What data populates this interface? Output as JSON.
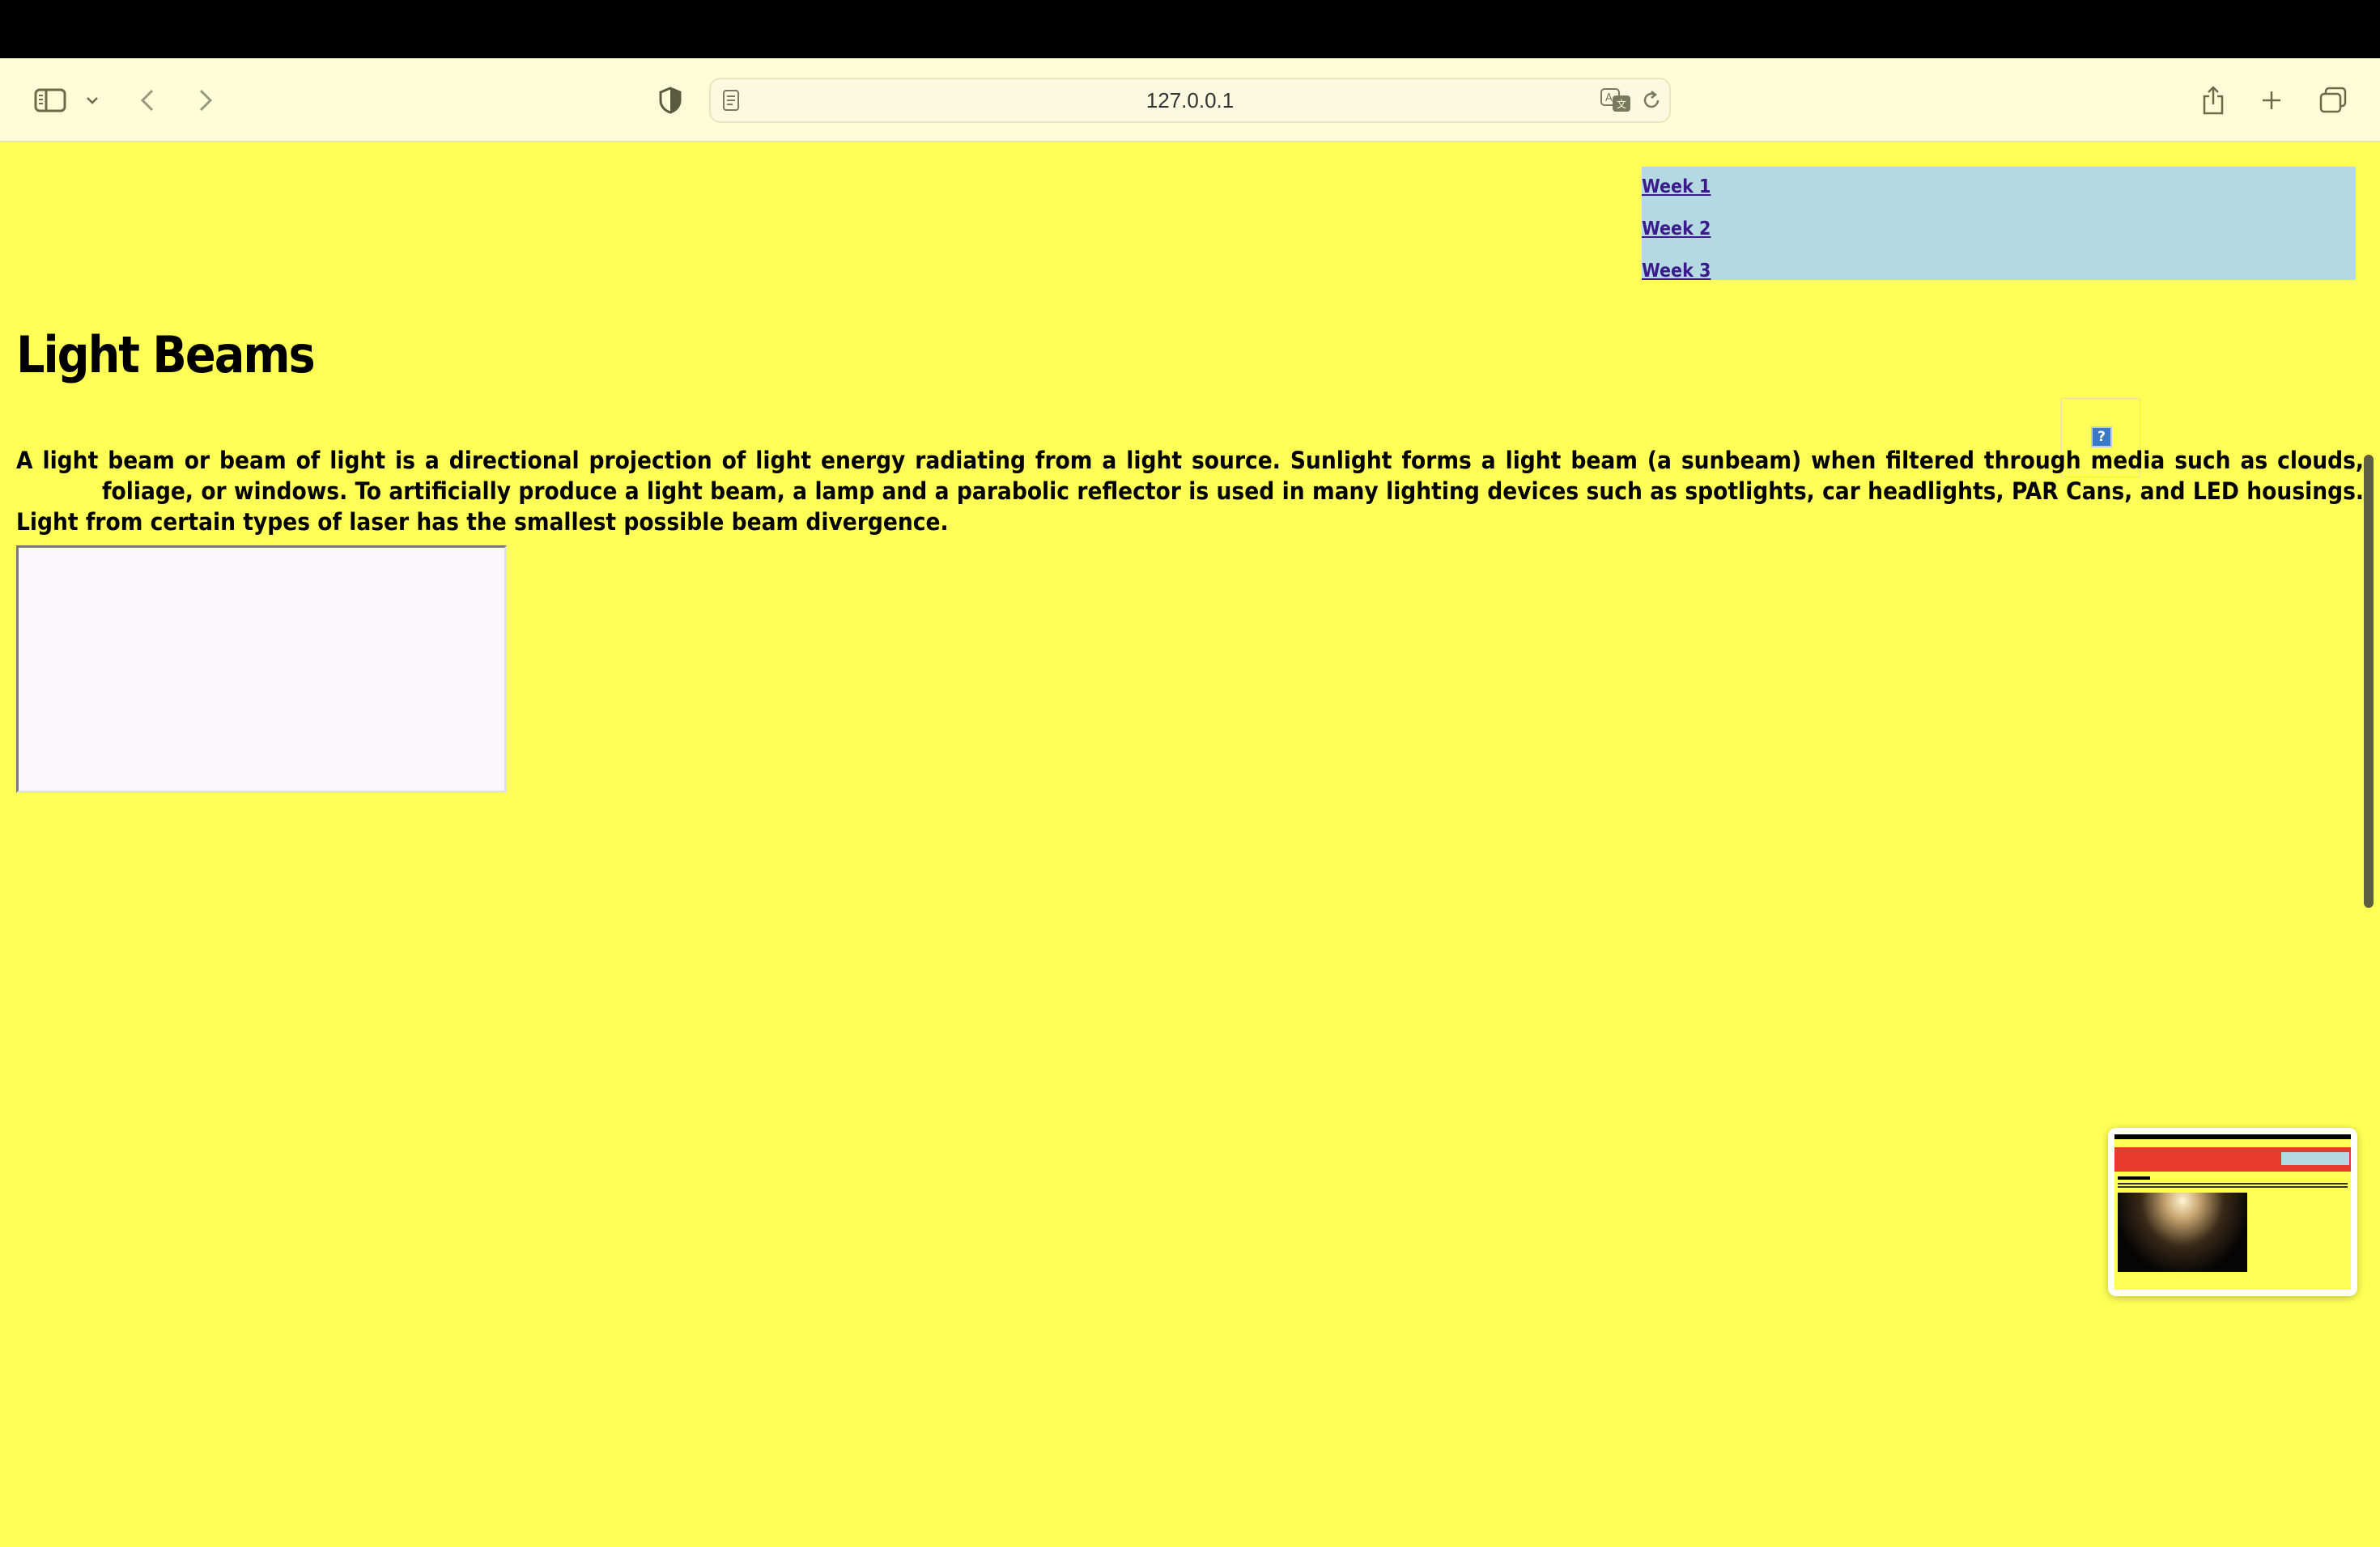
{
  "browser": {
    "url": "127.0.0.1"
  },
  "nav": {
    "links": [
      "Week 1",
      "Week 2",
      "Week 3"
    ]
  },
  "page": {
    "title": "Light Beams",
    "paragraph_part1": "A light beam or beam of light is a directional projection of light energy radiating from a light source. Sunlight forms a light beam (a sunbeam) when filtered through media such as clouds,",
    "paragraph_part2": "foliage, or windows. To artificially produce a light beam, a lamp and a parabolic reflector is used in many lighting devices such as spotlights, car headlights, PAR Cans, and LED housings. Light from certain types of laser has the smallest possible beam divergence.",
    "broken_image_glyph": "?"
  },
  "colors": {
    "page_background": "#ffff55",
    "nav_background": "#b4d9e3",
    "link": "#3b1a8c"
  },
  "icons": [
    "sidebar-icon",
    "chevron-down-icon",
    "back-icon",
    "forward-icon",
    "shield-icon",
    "page-icon",
    "translate-icon",
    "reload-icon",
    "share-icon",
    "new-tab-icon",
    "tabs-icon",
    "broken-image-icon"
  ]
}
